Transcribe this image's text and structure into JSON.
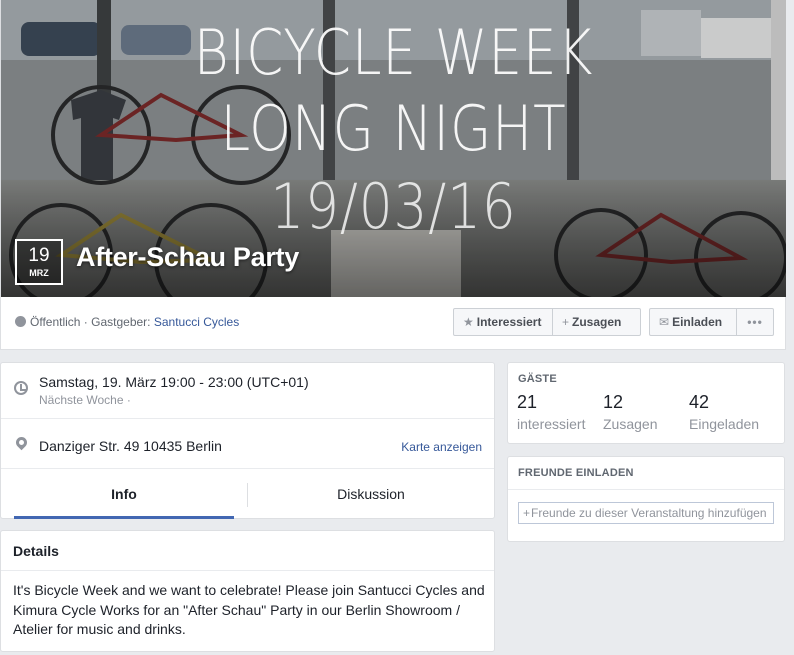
{
  "cover": {
    "poster_line1": "BICYCLE WEEK",
    "poster_line2": "LONG NIGHT",
    "poster_line3": "19/03/16",
    "date_day": "19",
    "date_month": "MRZ",
    "event_title": "After-Schau Party"
  },
  "meta": {
    "privacy": "Öffentlich · Gastgeber: ",
    "host": "Santucci Cycles",
    "icons": {
      "privacy": "globe-icon"
    }
  },
  "actions": {
    "interested": "Interessiert",
    "going": "Zusagen",
    "invite": "Einladen",
    "more": "•••",
    "icons": {
      "interested": "star-icon",
      "going": "plus-icon",
      "invite": "envelope-icon",
      "more": "more-icon"
    }
  },
  "info": {
    "time_main": "Samstag, 19. März 19:00 - 23:00 (UTC+01)",
    "time_sub": "Nächste Woche ·",
    "place_main": "Danziger Str. 49 10435 Berlin",
    "map_link": "Karte anzeigen",
    "icons": {
      "time": "clock-icon",
      "place": "location-pin-icon"
    }
  },
  "tabs": [
    {
      "label": "Info",
      "active": true
    },
    {
      "label": "Diskussion",
      "active": false
    }
  ],
  "details": {
    "heading": "Details",
    "body": "It's Bicycle Week and we want to celebrate! Please join Santucci Cycles and Kimura Cycle Works for an \"After Schau\" Party in our Berlin Showroom / Atelier for music and drinks."
  },
  "guests": {
    "heading": "GÄSTE",
    "stats": [
      {
        "count": "21",
        "label": "interessiert"
      },
      {
        "count": "12",
        "label": "Zusagen"
      },
      {
        "count": "42",
        "label": "Eingeladen"
      }
    ]
  },
  "invite_friends": {
    "heading": "FREUNDE EINLADEN",
    "placeholder": "Freunde zu dieser Veranstaltung hinzufügen"
  },
  "colors": {
    "link": "#365899",
    "accent": "#4267b2",
    "page_bg": "#e9ebee"
  }
}
